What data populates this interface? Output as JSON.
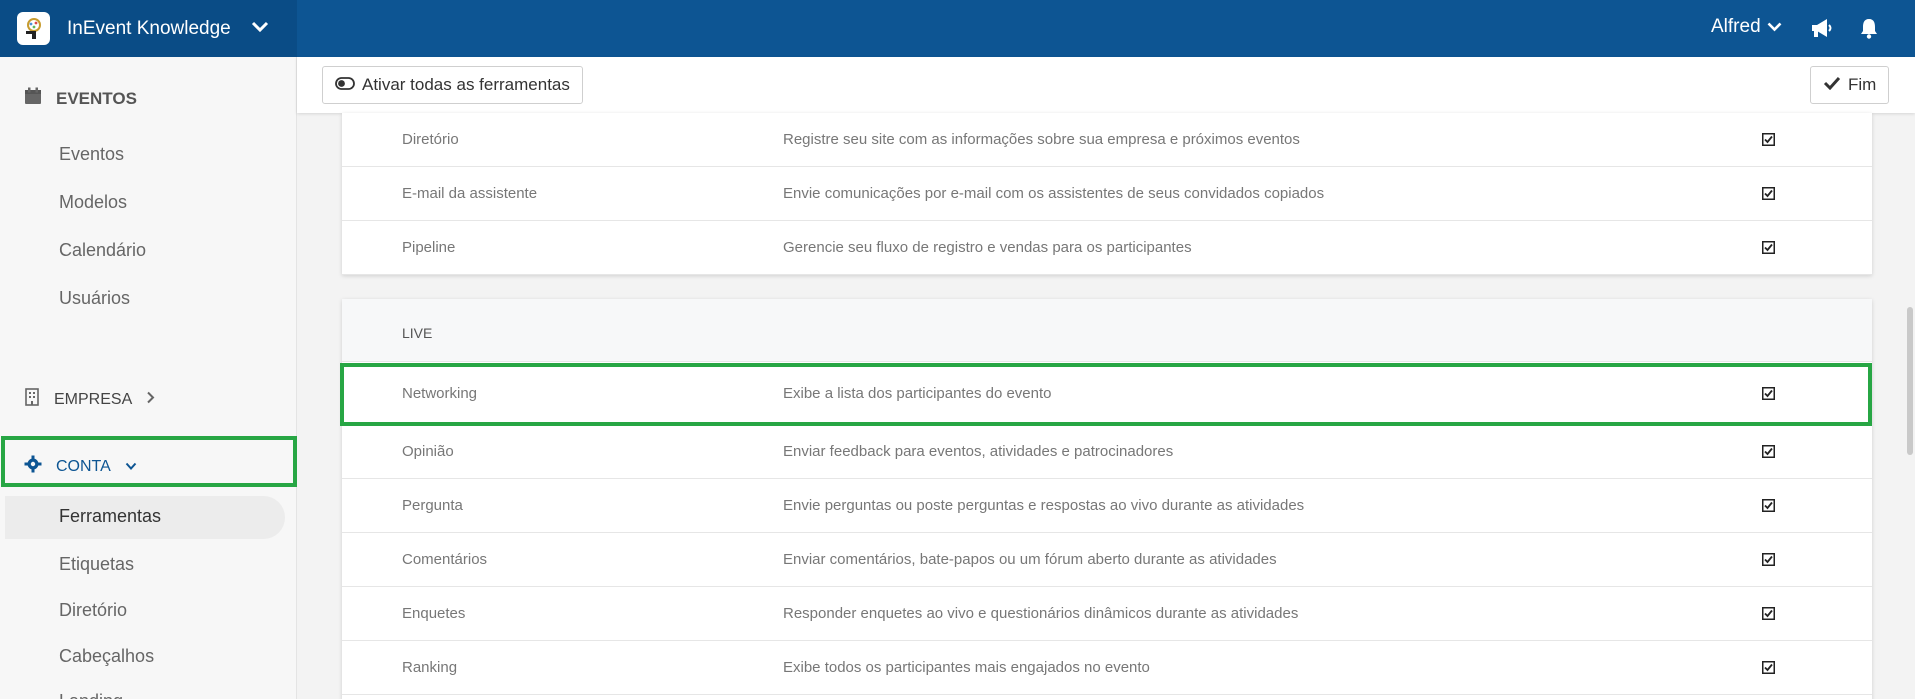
{
  "header": {
    "app_title": "InEvent Knowledge",
    "user_name": "Alfred",
    "icons": [
      "app-logo",
      "chevron-down",
      "megaphone",
      "bell"
    ],
    "colors": {
      "topbar": "#0d5593",
      "brand_bg": "#0a4c86",
      "highlight": "#27a644"
    }
  },
  "sidebar": {
    "eventos": {
      "label": "EVENTOS",
      "items": [
        "Eventos",
        "Modelos",
        "Calendário",
        "Usuários"
      ]
    },
    "empresa": {
      "label": "EMPRESA"
    },
    "conta": {
      "label": "CONTA",
      "items": [
        "Ferramentas",
        "Etiquetas",
        "Diretório",
        "Cabeçalhos",
        "Landing"
      ],
      "active": "Ferramentas"
    }
  },
  "toolbar": {
    "activate_all_label": "Ativar todas as ferramentas",
    "finish_label": "Fim"
  },
  "tools_top": [
    {
      "name": "Diretório",
      "desc": "Registre seu site com as informações sobre sua empresa e próximos eventos",
      "checked": true
    },
    {
      "name": "E-mail da assistente",
      "desc": "Envie comunicações por e-mail com os assistentes de seus convidados copiados",
      "checked": true
    },
    {
      "name": "Pipeline",
      "desc": "Gerencie seu fluxo de registro e vendas para os participantes",
      "checked": true
    }
  ],
  "live": {
    "section_label": "LIVE",
    "tools": [
      {
        "name": "Networking",
        "desc": "Exibe a lista dos participantes do evento",
        "checked": true
      },
      {
        "name": "Opinião",
        "desc": "Enviar feedback para eventos, atividades e patrocinadores",
        "checked": true
      },
      {
        "name": "Pergunta",
        "desc": "Envie perguntas ou poste perguntas e respostas ao vivo durante as atividades",
        "checked": true
      },
      {
        "name": "Comentários",
        "desc": "Enviar comentários, bate-papos ou um fórum aberto durante as atividades",
        "checked": true
      },
      {
        "name": "Enquetes",
        "desc": "Responder enquetes ao vivo e questionários dinâmicos durante as atividades",
        "checked": true
      },
      {
        "name": "Ranking",
        "desc": "Exibe todos os participantes mais engajados no evento",
        "checked": true
      }
    ]
  }
}
